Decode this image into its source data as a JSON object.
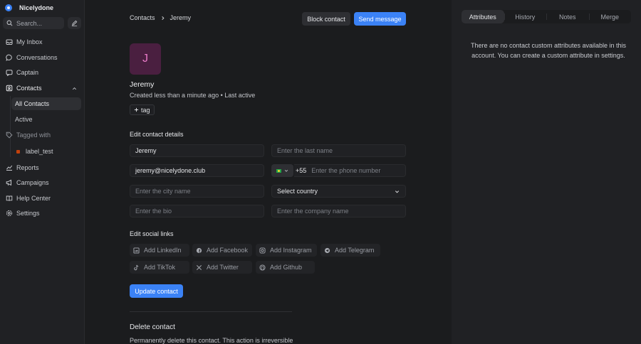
{
  "sidebar": {
    "brand": "Nicelydone",
    "search_placeholder": "Search...",
    "items": [
      {
        "label": "My Inbox",
        "icon": "inbox-icon"
      },
      {
        "label": "Conversations",
        "icon": "chat-icon"
      },
      {
        "label": "Captain",
        "icon": "captain-icon"
      },
      {
        "label": "Contacts",
        "icon": "contacts-icon"
      },
      {
        "label": "All Contacts"
      },
      {
        "label": "Active"
      },
      {
        "label": "Tagged with",
        "icon": "tag-icon"
      },
      {
        "label": "label_test"
      },
      {
        "label": "Reports",
        "icon": "reports-icon"
      },
      {
        "label": "Campaigns",
        "icon": "megaphone-icon"
      },
      {
        "label": "Help Center",
        "icon": "help-icon"
      },
      {
        "label": "Settings",
        "icon": "gear-icon"
      }
    ]
  },
  "header": {
    "breadcrumb_root": "Contacts",
    "breadcrumb_current": "Jeremy",
    "block_label": "Block contact",
    "send_label": "Send message"
  },
  "contact": {
    "initial": "J",
    "name": "Jeremy",
    "meta": "Created less than a minute ago • Last active",
    "tag_label": "tag"
  },
  "form": {
    "title": "Edit contact details",
    "first_name": "Jeremy",
    "last_name_placeholder": "Enter the last name",
    "email": "jeremy@nicelydone.club",
    "phone_code": "+55",
    "phone_placeholder": "Enter the phone number",
    "city_placeholder": "Enter the city name",
    "country_placeholder": "Select country",
    "bio_placeholder": "Enter the bio",
    "company_placeholder": "Enter the company name"
  },
  "social": {
    "title": "Edit social links",
    "links": [
      {
        "label": "Add LinkedIn",
        "icon": "linkedin-icon"
      },
      {
        "label": "Add Facebook",
        "icon": "facebook-icon"
      },
      {
        "label": "Add Instagram",
        "icon": "instagram-icon"
      },
      {
        "label": "Add Telegram",
        "icon": "telegram-icon"
      },
      {
        "label": "Add TikTok",
        "icon": "tiktok-icon"
      },
      {
        "label": "Add Twitter",
        "icon": "x-icon"
      },
      {
        "label": "Add Github",
        "icon": "github-icon"
      }
    ],
    "update_label": "Update contact"
  },
  "danger": {
    "title": "Delete contact",
    "text": "Permanently delete this contact. This action is irreversible"
  },
  "right_panel": {
    "tabs": [
      "Attributes",
      "History",
      "Notes",
      "Merge"
    ],
    "active_tab": "Attributes",
    "message": "There are no contact custom attributes available in this account. You can create a custom attribute in settings."
  },
  "colors": {
    "accent": "#3b82f6",
    "avatar_bg": "#4a1f40",
    "label_color": "#c2410c"
  }
}
